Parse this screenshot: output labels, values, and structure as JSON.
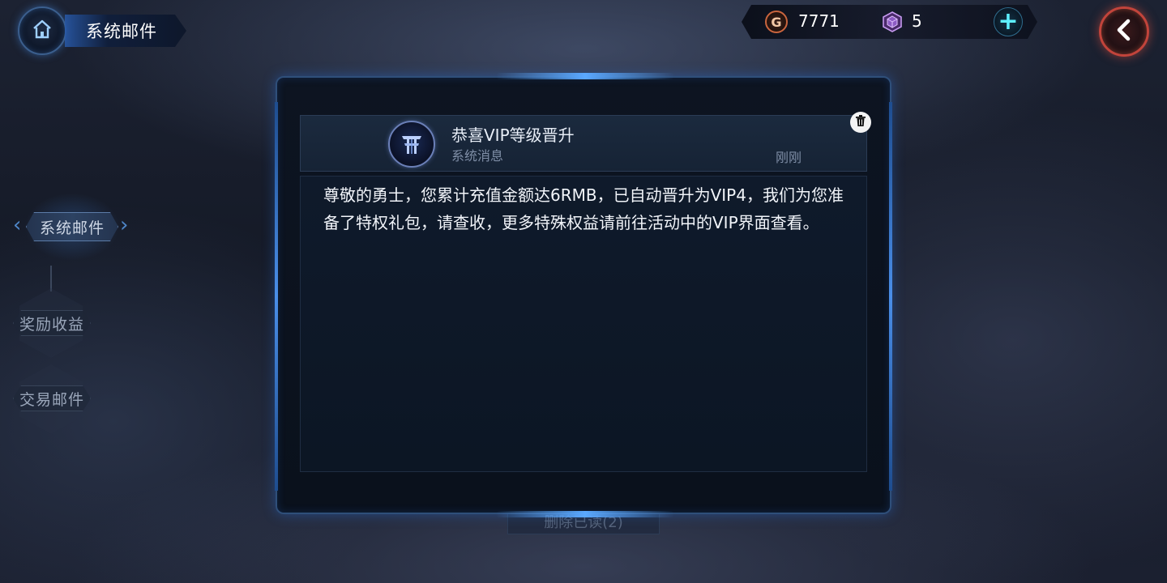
{
  "header": {
    "title": "系统邮件",
    "home_icon": "home-icon",
    "back_icon": "back-arrow-icon"
  },
  "currency": {
    "gold_symbol": "G",
    "gold": "7771",
    "gems": "5",
    "gem_icon": "gem-cube-icon",
    "add_icon": "plus-icon"
  },
  "nav": {
    "tabs": [
      {
        "label": "系统邮件",
        "active": true
      },
      {
        "label": "奖励收益",
        "active": false
      },
      {
        "label": "交易邮件",
        "active": false
      }
    ]
  },
  "mail": {
    "title": "恭喜VIP等级晋升",
    "type": "系统消息",
    "time": "刚刚",
    "body": "尊敬的勇士，您累计充值金额达6RMB，已自动晋升为VIP4，我们为您准备了特权礼包，请查收，更多特殊权益请前往活动中的VIP界面查看。",
    "sender_icon": "emblem-icon",
    "delete_icon": "trash-icon"
  },
  "footer": {
    "delete_read_label": "删除已读(2)"
  },
  "colors": {
    "accent_blue": "#4a8ee8",
    "back_red": "#c2443b",
    "plus_cyan": "#5ef0ff"
  }
}
